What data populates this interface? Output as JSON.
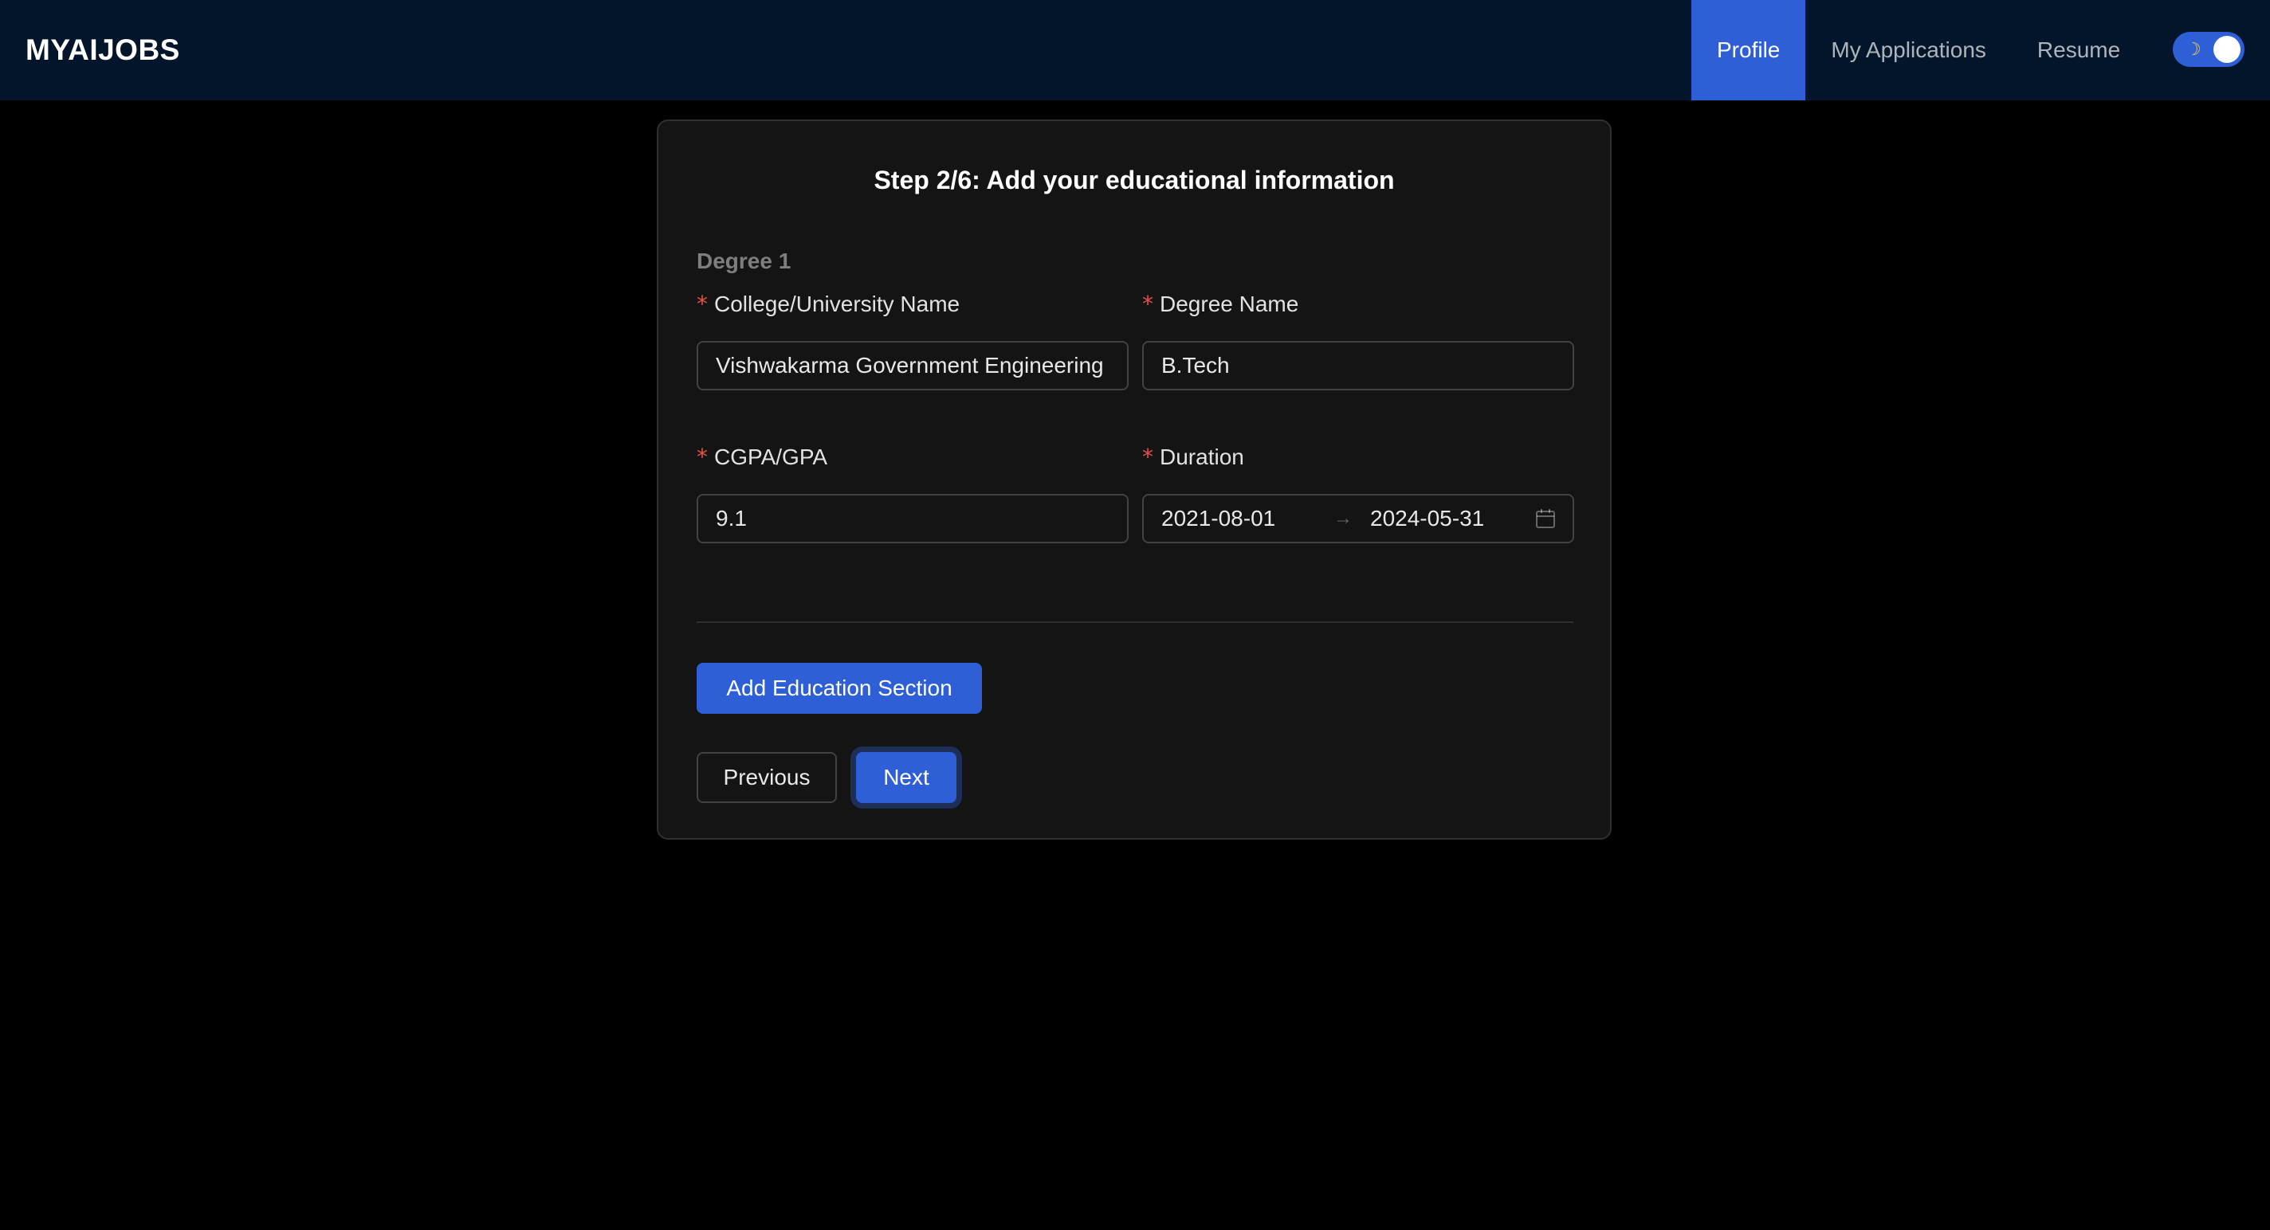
{
  "header": {
    "brand": "MYAIJOBS",
    "nav": [
      {
        "label": "Profile",
        "active": true
      },
      {
        "label": "My Applications",
        "active": false
      },
      {
        "label": "Resume",
        "active": false
      }
    ],
    "theme_toggle": {
      "icon": "moon-icon",
      "state": "dark"
    }
  },
  "form": {
    "title": "Step 2/6: Add your educational information",
    "section_title": "Degree 1",
    "required_mark": "*",
    "college": {
      "label": "College/University Name",
      "value": "Vishwakarma Government Engineering College"
    },
    "degree": {
      "label": "Degree Name",
      "value": "B.Tech"
    },
    "cgpa": {
      "label": "CGPA/GPA",
      "value": "9.1"
    },
    "duration": {
      "label": "Duration",
      "start": "2021-08-01",
      "separator": "→",
      "end": "2024-05-31",
      "icon": "calendar-icon"
    },
    "add_section_label": "Add Education Section",
    "previous_label": "Previous",
    "next_label": "Next"
  },
  "colors": {
    "header_bg": "#02152a",
    "accent": "#2f5fd6",
    "card_bg": "#141414",
    "required": "#e8514a"
  }
}
